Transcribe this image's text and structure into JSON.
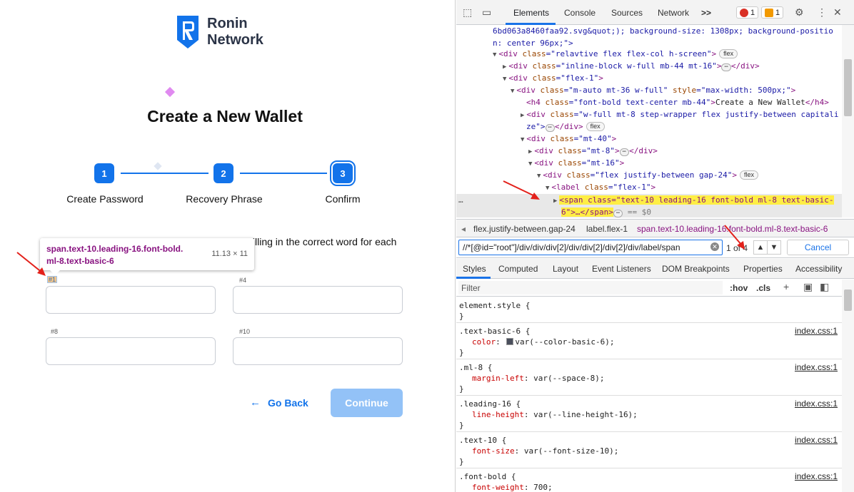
{
  "app": {
    "logo_line1": "Ronin",
    "logo_line2": "Network",
    "title": "Create a New Wallet",
    "steps": [
      {
        "number": "1",
        "label": "Create Password"
      },
      {
        "number": "2",
        "label": "Recovery Phrase"
      },
      {
        "number": "3",
        "label": "Confirm"
      }
    ],
    "instruction": "filling in the correct word for each",
    "tooltip": {
      "selector_line1": "span.text-10.leading-16.font-bold.",
      "selector_line2": "ml-8.text-basic-6",
      "size": "11.13 × 11"
    },
    "words": [
      "#1",
      "#4",
      "#8",
      "#10"
    ],
    "go_back": "Go Back",
    "continue": "Continue",
    "brand_color": "#1273ea"
  },
  "devtools": {
    "tabs": [
      "Elements",
      "Console",
      "Sources",
      "Network"
    ],
    "more_tabs": ">>",
    "error_count": "1",
    "warning_count": "1",
    "dom": {
      "l0": "6bd063a8460faa92.svg&quot;); background-size: 1308px; background-positio",
      "l1": "n: center 96px;\">",
      "l2_tag": "div",
      "l2_attr": "class",
      "l2_val": "\"relavtive flex flex-col h-screen\"",
      "l2_pill": "flex",
      "l3_tag": "div",
      "l3_val": "\"inline-block w-full mb-44 mt-16\"",
      "l3_close": "</div>",
      "l4_tag": "div",
      "l4_val": "\"flex-1\"",
      "l5_tag": "div",
      "l5_val": "\"m-auto mt-36 w-full\"",
      "l5_style": "style",
      "l5_style_val": "\"max-width: 500px;\"",
      "l6_tag": "h4",
      "l6_val": "\"font-bold text-center mb-44\"",
      "l6_text": "Create a New Wallet",
      "l6_close": "</h4>",
      "l7_tag": "div",
      "l7_val": "\"w-full mt-8 step-wrapper flex justify-between capitali",
      "l8": "ze\">",
      "l8_close": "</div>",
      "l8_pill": "flex",
      "l9_tag": "div",
      "l9_val": "\"mt-40\"",
      "l10_tag": "div",
      "l10_val": "\"mt-8\"",
      "l10_close": "</div>",
      "l11_tag": "div",
      "l11_val": "\"mt-16\"",
      "l12_tag": "div",
      "l12_val": "\"flex justify-between gap-24\"",
      "l12_pill": "flex",
      "l13_tag": "label",
      "l13_val": "\"flex-1\"",
      "sel_line1": "<span class=\"text-10 leading-16 font-bold ml-8 text-basic-",
      "sel_line2": "6\">…</span>",
      "sel_suffix": "== $0",
      "gutter": "…"
    },
    "breadcrumbs": [
      "flex.justify-between.gap-24",
      "label.flex-1",
      "span.text-10.leading-16.font-bold.ml-8.text-basic-6"
    ],
    "xpath": "//*[@id=\"root\"]/div/div/div[2]/div/div[2]/div[2]/div/label/span",
    "match_count": "1 of 4",
    "cancel": "Cancel",
    "style_tabs": [
      "Styles",
      "Computed",
      "Layout",
      "Event Listeners",
      "DOM Breakpoints",
      "Properties",
      "Accessibility"
    ],
    "filter_placeholder": "Filter",
    "hov": ":hov",
    "cls": ".cls",
    "rules": [
      {
        "selector": "element.style {",
        "prop": "",
        "value": "",
        "source": ""
      },
      {
        "selector": ".text-basic-6 {",
        "prop": "color",
        "value": "var(--color-basic-6);",
        "source": "index.css:1"
      },
      {
        "selector": ".ml-8 {",
        "prop": "margin-left",
        "value": "var(--space-8);",
        "source": "index.css:1"
      },
      {
        "selector": ".leading-16 {",
        "prop": "line-height",
        "value": "var(--line-height-16);",
        "source": "index.css:1"
      },
      {
        "selector": ".text-10 {",
        "prop": "font-size",
        "value": "var(--font-size-10);",
        "source": "index.css:1"
      },
      {
        "selector": ".font-bold {",
        "prop": "font-weight",
        "value": "700;",
        "source": "index.css:1"
      }
    ],
    "rule_close": "}"
  }
}
